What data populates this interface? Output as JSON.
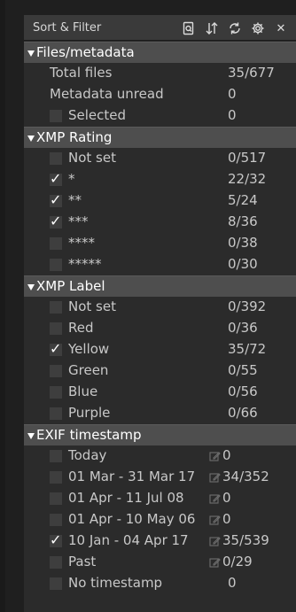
{
  "panel": {
    "title": "Sort & Filter",
    "icons": [
      "document-search-icon",
      "sort-icon",
      "refresh-icon",
      "settings-icon",
      "close-icon"
    ],
    "close_glyph": "✕"
  },
  "sections": [
    {
      "title": "Files/metadata",
      "items": [
        {
          "label": "Total files",
          "value": "35/677",
          "checkbox": false,
          "checked": false,
          "edit": false
        },
        {
          "label": "Metadata unread",
          "value": "0",
          "checkbox": false,
          "checked": false,
          "edit": false
        },
        {
          "label": "Selected",
          "value": "0",
          "checkbox": true,
          "checked": false,
          "edit": false
        }
      ]
    },
    {
      "title": "XMP Rating",
      "items": [
        {
          "label": "Not set",
          "value": "0/517",
          "checkbox": true,
          "checked": false,
          "edit": false
        },
        {
          "label": "*",
          "value": "22/32",
          "checkbox": true,
          "checked": true,
          "edit": false
        },
        {
          "label": "**",
          "value": "5/24",
          "checkbox": true,
          "checked": true,
          "edit": false
        },
        {
          "label": "***",
          "value": "8/36",
          "checkbox": true,
          "checked": true,
          "edit": false
        },
        {
          "label": "****",
          "value": "0/38",
          "checkbox": true,
          "checked": false,
          "edit": false
        },
        {
          "label": "*****",
          "value": "0/30",
          "checkbox": true,
          "checked": false,
          "edit": false
        }
      ]
    },
    {
      "title": "XMP Label",
      "items": [
        {
          "label": "Not set",
          "value": "0/392",
          "checkbox": true,
          "checked": false,
          "edit": false
        },
        {
          "label": "Red",
          "value": "0/36",
          "checkbox": true,
          "checked": false,
          "edit": false
        },
        {
          "label": "Yellow",
          "value": "35/72",
          "checkbox": true,
          "checked": true,
          "edit": false
        },
        {
          "label": "Green",
          "value": "0/55",
          "checkbox": true,
          "checked": false,
          "edit": false
        },
        {
          "label": "Blue",
          "value": "0/56",
          "checkbox": true,
          "checked": false,
          "edit": false
        },
        {
          "label": "Purple",
          "value": "0/66",
          "checkbox": true,
          "checked": false,
          "edit": false
        }
      ]
    },
    {
      "title": "EXIF timestamp",
      "items": [
        {
          "label": "Today",
          "value": "0",
          "checkbox": true,
          "checked": false,
          "edit": true
        },
        {
          "label": "01 Mar - 31 Mar 17",
          "value": "34/352",
          "checkbox": true,
          "checked": false,
          "edit": true
        },
        {
          "label": "01 Apr - 11 Jul 08",
          "value": "0",
          "checkbox": true,
          "checked": false,
          "edit": true
        },
        {
          "label": "01 Apr - 10 May 06",
          "value": "0",
          "checkbox": true,
          "checked": false,
          "edit": true
        },
        {
          "label": "10 Jan - 04 Apr 17",
          "value": "35/539",
          "checkbox": true,
          "checked": true,
          "edit": true
        },
        {
          "label": "Past",
          "value": "0/29",
          "checkbox": true,
          "checked": false,
          "edit": true
        },
        {
          "label": "No timestamp",
          "value": "0",
          "checkbox": true,
          "checked": false,
          "edit": false
        }
      ]
    }
  ],
  "colors": {
    "background": "#1f1f1f",
    "panel": "#2b2b2b",
    "header": "#4e4e4e",
    "text": "#c8c8c8",
    "header_text": "#ffffff"
  }
}
